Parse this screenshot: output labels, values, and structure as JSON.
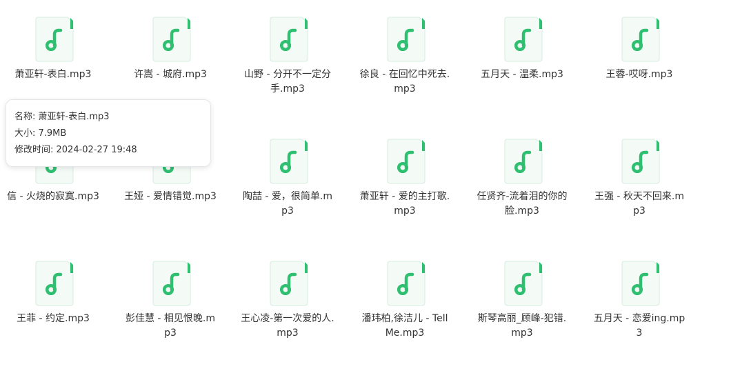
{
  "colors": {
    "icon_accent": "#2fbf71",
    "icon_paper": "#f4faf6",
    "icon_border": "#d6ece0",
    "text": "#333333"
  },
  "file_icon": "music-note-file-icon",
  "files": [
    {
      "name": "萧亚轩-表白.mp3"
    },
    {
      "name": "许嵩 - 城府.mp3"
    },
    {
      "name": "山野 - 分开不一定分手.mp3"
    },
    {
      "name": "徐良 - 在回忆中死去.mp3"
    },
    {
      "name": "五月天 - 温柔.mp3"
    },
    {
      "name": "王蓉-哎呀.mp3"
    },
    {
      "name": "信 - 火烧的寂寞.mp3"
    },
    {
      "name": "王娅 - 爱情错觉.mp3"
    },
    {
      "name": "陶喆 - 爱，很简单.mp3"
    },
    {
      "name": "萧亚轩 - 爱的主打歌.mp3"
    },
    {
      "name": "任贤齐-流着泪的你的脸.mp3"
    },
    {
      "name": "王强 - 秋天不回来.mp3"
    },
    {
      "name": "王菲 - 约定.mp3"
    },
    {
      "name": "彭佳慧 - 相见恨晚.mp3"
    },
    {
      "name": "王心凌-第一次爱的人.mp3"
    },
    {
      "name": "潘玮柏,徐洁儿 - Tell Me.mp3"
    },
    {
      "name": "斯琴高丽_顾峰-犯错.mp3"
    },
    {
      "name": "五月天 - 恋爱ing.mp3"
    }
  ],
  "tooltip": {
    "name_line": "名称: 萧亚轩-表白.mp3",
    "size_line": "大小: 7.9MB",
    "modified_line": "修改时间: 2024-02-27 19:48"
  }
}
